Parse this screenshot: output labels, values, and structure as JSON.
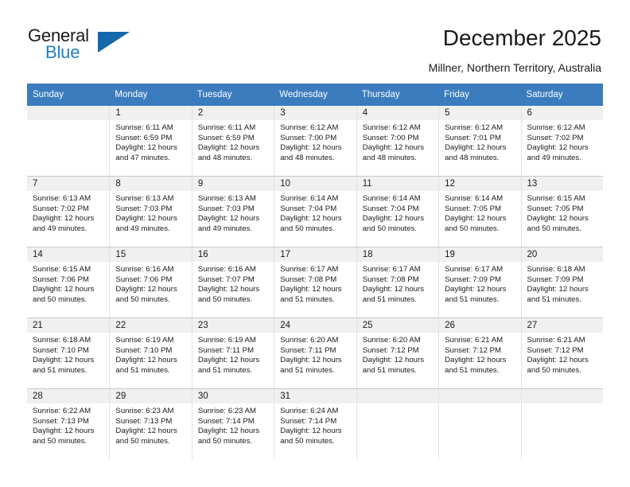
{
  "logo": {
    "word1": "General",
    "word2": "Blue",
    "triangle_color": "#1567ab"
  },
  "header": {
    "title": "December 2025",
    "subtitle": "Millner, Northern Territory, Australia",
    "header_bg": "#3a7cbe"
  },
  "weekday_headers": [
    "Sunday",
    "Monday",
    "Tuesday",
    "Wednesday",
    "Thursday",
    "Friday",
    "Saturday"
  ],
  "weeks": [
    [
      {
        "day": "",
        "lines": []
      },
      {
        "day": "1",
        "lines": [
          "Sunrise: 6:11 AM",
          "Sunset: 6:59 PM",
          "Daylight: 12 hours",
          "and 47 minutes."
        ]
      },
      {
        "day": "2",
        "lines": [
          "Sunrise: 6:11 AM",
          "Sunset: 6:59 PM",
          "Daylight: 12 hours",
          "and 48 minutes."
        ]
      },
      {
        "day": "3",
        "lines": [
          "Sunrise: 6:12 AM",
          "Sunset: 7:00 PM",
          "Daylight: 12 hours",
          "and 48 minutes."
        ]
      },
      {
        "day": "4",
        "lines": [
          "Sunrise: 6:12 AM",
          "Sunset: 7:00 PM",
          "Daylight: 12 hours",
          "and 48 minutes."
        ]
      },
      {
        "day": "5",
        "lines": [
          "Sunrise: 6:12 AM",
          "Sunset: 7:01 PM",
          "Daylight: 12 hours",
          "and 48 minutes."
        ]
      },
      {
        "day": "6",
        "lines": [
          "Sunrise: 6:12 AM",
          "Sunset: 7:02 PM",
          "Daylight: 12 hours",
          "and 49 minutes."
        ]
      }
    ],
    [
      {
        "day": "7",
        "lines": [
          "Sunrise: 6:13 AM",
          "Sunset: 7:02 PM",
          "Daylight: 12 hours",
          "and 49 minutes."
        ]
      },
      {
        "day": "8",
        "lines": [
          "Sunrise: 6:13 AM",
          "Sunset: 7:03 PM",
          "Daylight: 12 hours",
          "and 49 minutes."
        ]
      },
      {
        "day": "9",
        "lines": [
          "Sunrise: 6:13 AM",
          "Sunset: 7:03 PM",
          "Daylight: 12 hours",
          "and 49 minutes."
        ]
      },
      {
        "day": "10",
        "lines": [
          "Sunrise: 6:14 AM",
          "Sunset: 7:04 PM",
          "Daylight: 12 hours",
          "and 50 minutes."
        ]
      },
      {
        "day": "11",
        "lines": [
          "Sunrise: 6:14 AM",
          "Sunset: 7:04 PM",
          "Daylight: 12 hours",
          "and 50 minutes."
        ]
      },
      {
        "day": "12",
        "lines": [
          "Sunrise: 6:14 AM",
          "Sunset: 7:05 PM",
          "Daylight: 12 hours",
          "and 50 minutes."
        ]
      },
      {
        "day": "13",
        "lines": [
          "Sunrise: 6:15 AM",
          "Sunset: 7:05 PM",
          "Daylight: 12 hours",
          "and 50 minutes."
        ]
      }
    ],
    [
      {
        "day": "14",
        "lines": [
          "Sunrise: 6:15 AM",
          "Sunset: 7:06 PM",
          "Daylight: 12 hours",
          "and 50 minutes."
        ]
      },
      {
        "day": "15",
        "lines": [
          "Sunrise: 6:16 AM",
          "Sunset: 7:06 PM",
          "Daylight: 12 hours",
          "and 50 minutes."
        ]
      },
      {
        "day": "16",
        "lines": [
          "Sunrise: 6:16 AM",
          "Sunset: 7:07 PM",
          "Daylight: 12 hours",
          "and 50 minutes."
        ]
      },
      {
        "day": "17",
        "lines": [
          "Sunrise: 6:17 AM",
          "Sunset: 7:08 PM",
          "Daylight: 12 hours",
          "and 51 minutes."
        ]
      },
      {
        "day": "18",
        "lines": [
          "Sunrise: 6:17 AM",
          "Sunset: 7:08 PM",
          "Daylight: 12 hours",
          "and 51 minutes."
        ]
      },
      {
        "day": "19",
        "lines": [
          "Sunrise: 6:17 AM",
          "Sunset: 7:09 PM",
          "Daylight: 12 hours",
          "and 51 minutes."
        ]
      },
      {
        "day": "20",
        "lines": [
          "Sunrise: 6:18 AM",
          "Sunset: 7:09 PM",
          "Daylight: 12 hours",
          "and 51 minutes."
        ]
      }
    ],
    [
      {
        "day": "21",
        "lines": [
          "Sunrise: 6:18 AM",
          "Sunset: 7:10 PM",
          "Daylight: 12 hours",
          "and 51 minutes."
        ]
      },
      {
        "day": "22",
        "lines": [
          "Sunrise: 6:19 AM",
          "Sunset: 7:10 PM",
          "Daylight: 12 hours",
          "and 51 minutes."
        ]
      },
      {
        "day": "23",
        "lines": [
          "Sunrise: 6:19 AM",
          "Sunset: 7:11 PM",
          "Daylight: 12 hours",
          "and 51 minutes."
        ]
      },
      {
        "day": "24",
        "lines": [
          "Sunrise: 6:20 AM",
          "Sunset: 7:11 PM",
          "Daylight: 12 hours",
          "and 51 minutes."
        ]
      },
      {
        "day": "25",
        "lines": [
          "Sunrise: 6:20 AM",
          "Sunset: 7:12 PM",
          "Daylight: 12 hours",
          "and 51 minutes."
        ]
      },
      {
        "day": "26",
        "lines": [
          "Sunrise: 6:21 AM",
          "Sunset: 7:12 PM",
          "Daylight: 12 hours",
          "and 51 minutes."
        ]
      },
      {
        "day": "27",
        "lines": [
          "Sunrise: 6:21 AM",
          "Sunset: 7:12 PM",
          "Daylight: 12 hours",
          "and 50 minutes."
        ]
      }
    ],
    [
      {
        "day": "28",
        "lines": [
          "Sunrise: 6:22 AM",
          "Sunset: 7:13 PM",
          "Daylight: 12 hours",
          "and 50 minutes."
        ]
      },
      {
        "day": "29",
        "lines": [
          "Sunrise: 6:23 AM",
          "Sunset: 7:13 PM",
          "Daylight: 12 hours",
          "and 50 minutes."
        ]
      },
      {
        "day": "30",
        "lines": [
          "Sunrise: 6:23 AM",
          "Sunset: 7:14 PM",
          "Daylight: 12 hours",
          "and 50 minutes."
        ]
      },
      {
        "day": "31",
        "lines": [
          "Sunrise: 6:24 AM",
          "Sunset: 7:14 PM",
          "Daylight: 12 hours",
          "and 50 minutes."
        ]
      },
      {
        "day": "",
        "lines": []
      },
      {
        "day": "",
        "lines": []
      },
      {
        "day": "",
        "lines": []
      }
    ]
  ]
}
